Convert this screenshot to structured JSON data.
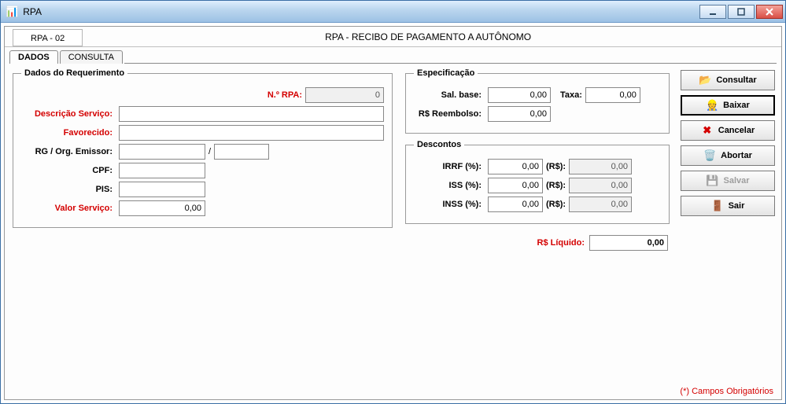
{
  "window": {
    "title": "RPA"
  },
  "header": {
    "tab": "RPA - 02",
    "title": "RPA - RECIBO DE PAGAMENTO A AUTÔNOMO"
  },
  "tabs": {
    "dados": "DADOS",
    "consulta": "CONSULTA"
  },
  "fieldsets": {
    "requerimento": "Dados do Requerimento",
    "especificacao": "Especificação",
    "descontos": "Descontos"
  },
  "labels": {
    "nrpa": "N.º RPA:",
    "descricao": "Descrição Serviço:",
    "favorecido": "Favorecido:",
    "rg": "RG / Org. Emissor:",
    "rg_sep": "/",
    "cpf": "CPF:",
    "pis": "PIS:",
    "valor": "Valor Serviço:",
    "salbase": "Sal. base:",
    "taxa": "Taxa:",
    "reembolso": "R$ Reembolso:",
    "irrf": "IRRF (%):",
    "iss": "ISS (%):",
    "inss": "INSS (%):",
    "rs": "(R$):",
    "liquido": "R$ Líquido:"
  },
  "values": {
    "nrpa": "0",
    "descricao": "",
    "favorecido": "",
    "rg": "",
    "emissor": "",
    "cpf": "",
    "pis": "",
    "valor": "0,00",
    "salbase": "0,00",
    "taxa": "0,00",
    "reembolso": "0,00",
    "irrf_pct": "0,00",
    "irrf_rs": "0,00",
    "iss_pct": "0,00",
    "iss_rs": "0,00",
    "inss_pct": "0,00",
    "inss_rs": "0,00",
    "liquido": "0,00"
  },
  "buttons": {
    "consultar": "Consultar",
    "baixar": "Baixar",
    "cancelar": "Cancelar",
    "abortar": "Abortar",
    "salvar": "Salvar",
    "sair": "Sair"
  },
  "footer": "(*) Campos Obrigatórios"
}
